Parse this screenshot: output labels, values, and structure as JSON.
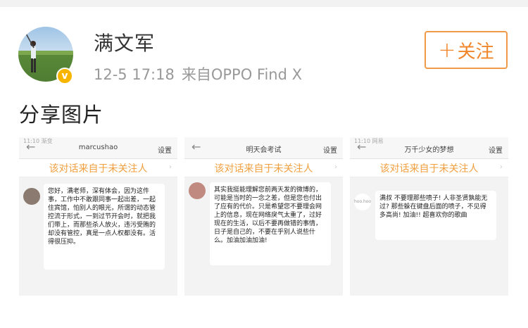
{
  "post": {
    "username": "满文军",
    "time": "12-5 17:18",
    "source": "来自OPPO Find X",
    "follow_label": "关注",
    "follow_plus": "+",
    "verified_mark": "v",
    "text": "分享图片"
  },
  "screenshots": [
    {
      "status": "11:10 渐变",
      "back": "←",
      "title": "marcushao",
      "settings": "设置",
      "banner": "该对话来自于未关注人",
      "banner_arrow": "›",
      "message": "您好，满老师，深有体会，因为这件事，工作中不敢跟同事一起出差，一起住宾馆，怕别人的眼光，所谓的动态管控流于形式，一到过节开会时，就把我们带上，而那些杀人放火，违污受贿的却没有管控，真是一点人权都没有。活得很压抑。"
    },
    {
      "status": "",
      "back": "←",
      "title": "明天会考试",
      "settings": "设置",
      "banner": "该对话来自于未关注人",
      "banner_arrow": "›",
      "message": "其实我挺能理解您前两天发的微博的，可能是当时的一念之差，但是您也付出了应有的代价。只是希望您不要理会网上的信息，现在网络戾气太重了，过好现在的生活，以后不要再做错的事情，日子是自己的，不要在乎别人说些什么。加油加油加油!"
    },
    {
      "status": "11:10 网易",
      "back": "←",
      "title": "万千少女的梦想",
      "settings": "设置",
      "banner": "该对话来自于未关注人",
      "banner_arrow": "›",
      "avatar_text": "hoo.hoo",
      "message": "满叔 不要理那些喷子! 人非圣贤孰能无过? 那些躲在键盘后面的喷子，不见得多高尚! 加油!! 超喜欢你的歌曲"
    }
  ]
}
